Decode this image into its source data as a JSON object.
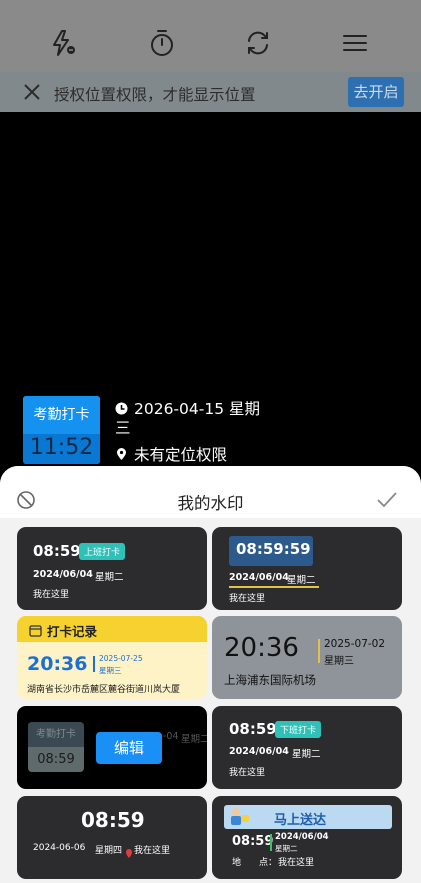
{
  "top_bar": {
    "icons": [
      "flash-auto-icon",
      "timer-icon",
      "switch-camera-icon",
      "menu-icon"
    ]
  },
  "permission_banner": {
    "text": "授权位置权限，才能显示位置",
    "button": "去开启"
  },
  "preview_watermark": {
    "label": "考勤打卡",
    "time": "11:52",
    "date": "2026-04-15 星期三",
    "location": "未有定位权限"
  },
  "sheet": {
    "title": "我的水印"
  },
  "cards": {
    "c1": {
      "time": "08:59",
      "tag": "上班打卡",
      "date": "2024/06/04",
      "weekday": "星期二",
      "place": "我在这里"
    },
    "c2": {
      "time": "08:59:59",
      "date": "2024/06/04",
      "weekday": "星期二",
      "place": "我在这里"
    },
    "c3": {
      "header": "打卡记录",
      "time": "20:36",
      "date": "2025-07-25",
      "weekday": "星期三",
      "address": "湖南省长沙市岳麓区麓谷街道川岚大厦"
    },
    "c4": {
      "time": "20:36",
      "date": "2025-07-02",
      "weekday": "星期三",
      "place": "上海浦东国际机场"
    },
    "c5": {
      "label": "考勤打卡",
      "time": "08:59",
      "date_partial": "-04",
      "weekday": "星期二",
      "edit": "编辑"
    },
    "c6": {
      "time": "08:59",
      "tag": "下班打卡",
      "date": "2024/06/04",
      "weekday": "星期二",
      "place": "我在这里"
    },
    "c7": {
      "time": "08:59",
      "date": "2024-06-06",
      "weekday": "星期四",
      "place": "我在这里"
    },
    "c8": {
      "banner": "马上送达",
      "time": "08:59",
      "date": "2024/06/04",
      "weekday": "星期二",
      "place_label": "地　　点：",
      "place": "我在这里"
    }
  }
}
